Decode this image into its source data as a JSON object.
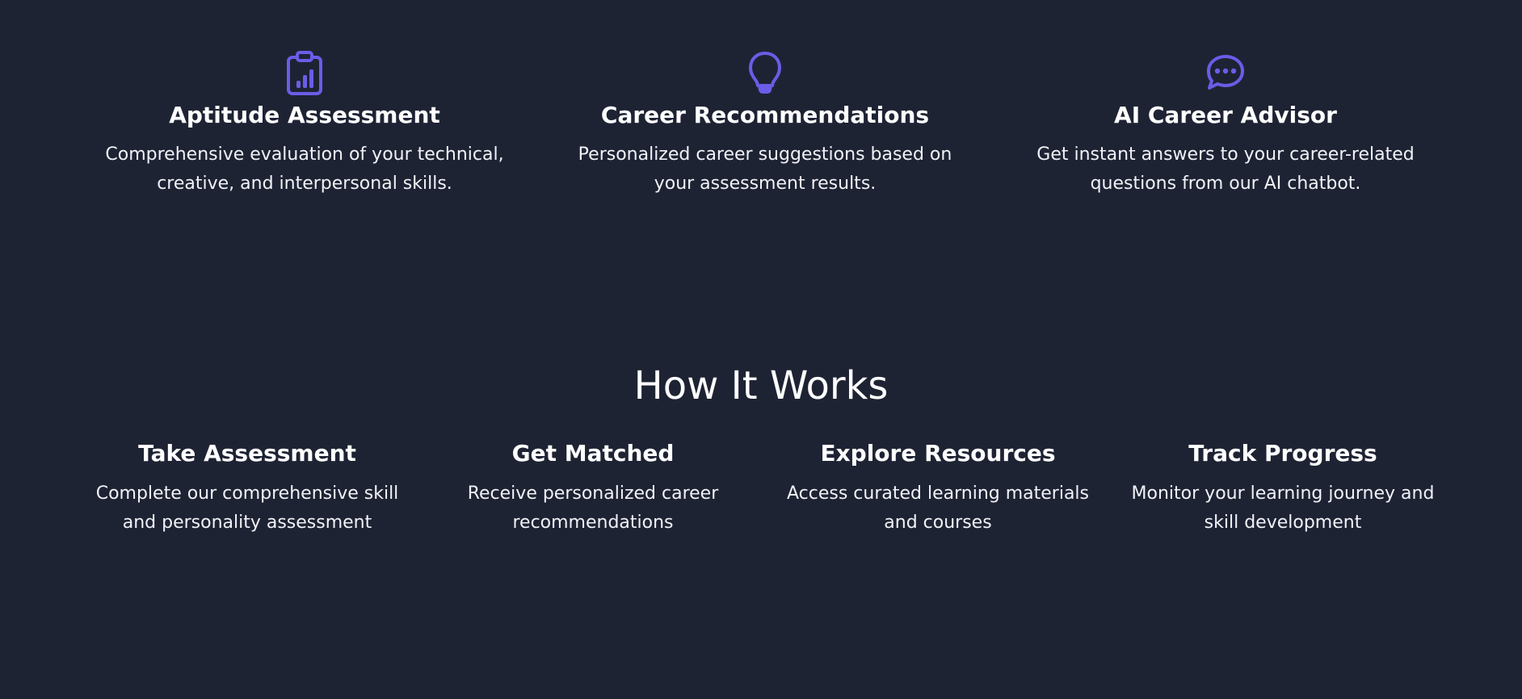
{
  "accent_color": "#6c5ce7",
  "background_color": "#1e2334",
  "features": [
    {
      "icon": "clipboard-chart-icon",
      "title": "Aptitude Assessment",
      "description": "Comprehensive evaluation of your technical, creative, and interpersonal skills."
    },
    {
      "icon": "lightbulb-icon",
      "title": "Career Recommendations",
      "description": "Personalized career suggestions based on your assessment results."
    },
    {
      "icon": "chat-bubble-icon",
      "title": "AI Career Advisor",
      "description": "Get instant answers to your career-related questions from our AI chatbot."
    }
  ],
  "how_it_works": {
    "title": "How It Works",
    "steps": [
      {
        "title": "Take Assessment",
        "description": "Complete our comprehensive skill and personality assessment"
      },
      {
        "title": "Get Matched",
        "description": "Receive personalized career recommendations"
      },
      {
        "title": "Explore Resources",
        "description": "Access curated learning materials and courses"
      },
      {
        "title": "Track Progress",
        "description": "Monitor your learning journey and skill development"
      }
    ]
  }
}
